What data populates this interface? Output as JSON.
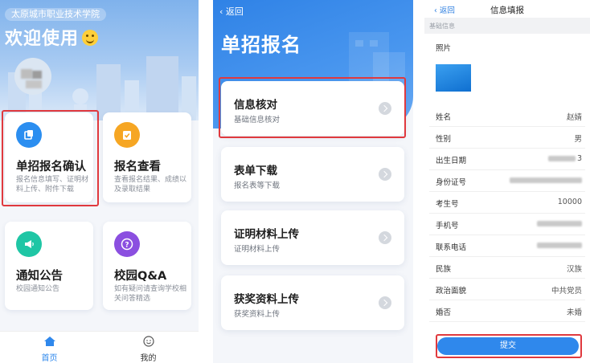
{
  "home": {
    "school_name": "太原城市职业技术学院",
    "welcome": "欢迎使用",
    "cards": [
      {
        "title": "单招报名确认",
        "desc": "报名信息填写、证明材料上传、附件下载",
        "color": "#2b8ef0",
        "icon": "document-stack-icon"
      },
      {
        "title": "报名查看",
        "desc": "查看报名结果、成绩以及录取结果",
        "color": "#f6a623",
        "icon": "clipboard-check-icon"
      },
      {
        "title": "通知公告",
        "desc": "校园通知公告",
        "color": "#1fc6a5",
        "icon": "megaphone-icon"
      },
      {
        "title": "校园Q&A",
        "desc": "如有疑问请查询学校相关问答精选",
        "color": "#8b4fe0",
        "icon": "question-mark-icon"
      }
    ],
    "tabs": [
      {
        "label": "首页",
        "icon": "home-icon",
        "active": true
      },
      {
        "label": "我的",
        "icon": "smiley-face-icon",
        "active": false
      }
    ]
  },
  "registration": {
    "back_label": "返回",
    "title": "单招报名",
    "items": [
      {
        "title": "信息核对",
        "subtitle": "基础信息核对"
      },
      {
        "title": "表单下载",
        "subtitle": "报名表等下载"
      },
      {
        "title": "证明材料上传",
        "subtitle": "证明材料上传"
      },
      {
        "title": "获奖资料上传",
        "subtitle": "获奖资料上传"
      }
    ]
  },
  "form": {
    "back_label": "返回",
    "title": "信息填报",
    "section_label": "基础信息",
    "photo_label": "照片",
    "fields": [
      {
        "label": "姓名",
        "value": "赵婧"
      },
      {
        "label": "性别",
        "value": "男"
      },
      {
        "label": "出生日期",
        "value": "3"
      },
      {
        "label": "身份证号",
        "value": ""
      },
      {
        "label": "考生号",
        "value": "10000"
      },
      {
        "label": "手机号",
        "value": ""
      },
      {
        "label": "联系电话",
        "value": ""
      },
      {
        "label": "民族",
        "value": "汉族"
      },
      {
        "label": "政治面貌",
        "value": "中共党员"
      },
      {
        "label": "婚否",
        "value": "未婚"
      }
    ],
    "submit_label": "提交"
  },
  "colors": {
    "accent": "#2f88ec",
    "highlight_border": "#e0393e"
  }
}
